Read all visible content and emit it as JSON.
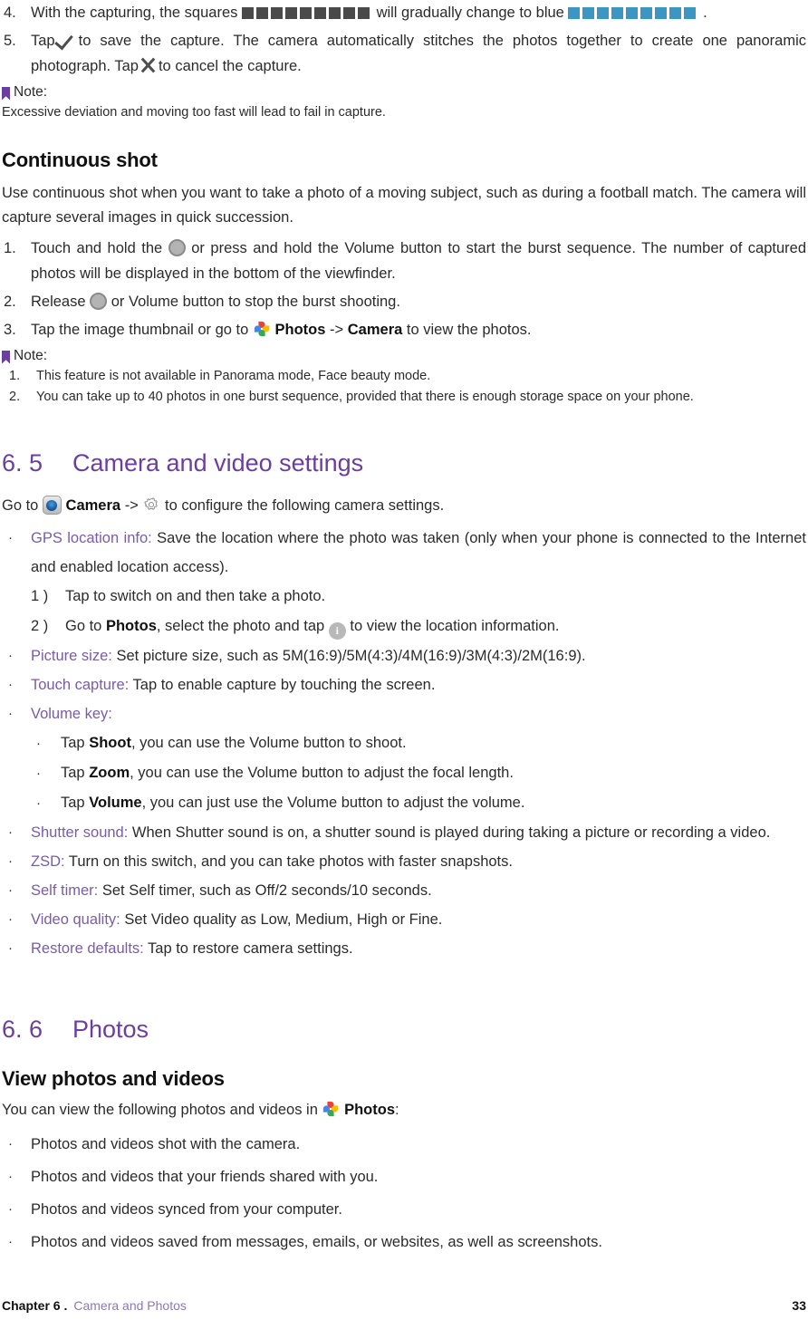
{
  "colors": {
    "accent_purple": "#6b3fa0",
    "keyword_purple": "#7a5ca8",
    "square_dark": "#4a4a4a",
    "square_blue": "#3b97c2",
    "body_text": "#2b2b2b"
  },
  "steps_panorama": [
    {
      "marker": "4.",
      "text_before": "With the capturing, the squares",
      "text_middle": "will gradually change to blue",
      "text_after": ".",
      "squares_dark_count": 9,
      "squares_blue_count": 9
    },
    {
      "marker": "5.",
      "part1": "Tap",
      "part2": "to save the capture. The camera automatically stitches the photos together to create one panoramic photograph. Tap",
      "part3": "to cancel the capture.",
      "icon_save": "check-icon",
      "icon_cancel": "close-icon"
    }
  ],
  "note_panorama": {
    "label": "Note:",
    "body": "Excessive deviation and moving too fast will lead to fail in capture."
  },
  "continuous_shot": {
    "heading": "Continuous shot",
    "intro": "Use continuous shot when you want to take a photo of a moving subject, such as during a football match. The camera will capture several images in quick succession.",
    "steps": [
      {
        "marker": "1.",
        "part1": "Touch and hold the",
        "part2": "or press and hold the Volume button to start the burst sequence. The number of captured photos will be displayed in the bottom of the viewfinder.",
        "icon": "shutter-button-icon"
      },
      {
        "marker": "2.",
        "part1": "Release",
        "part2": "or Volume button to stop the burst shooting.",
        "icon": "shutter-button-icon"
      },
      {
        "marker": "3.",
        "part1": "Tap the image thumbnail or go to",
        "app": "Photos",
        "arrow": "->",
        "target": "Camera",
        "part2": "to view the photos.",
        "icon": "google-photos-icon"
      }
    ],
    "note": {
      "label": "Note:",
      "items": [
        {
          "marker": "1.",
          "text": "This feature is not available in Panorama mode, Face beauty mode."
        },
        {
          "marker": "2.",
          "text": "You can take up to 40 photos in one burst sequence, provided that there is enough storage space on your phone."
        }
      ]
    }
  },
  "section_65": {
    "number": "6. 5",
    "title": "Camera and video settings",
    "intro": {
      "part1": "Go to",
      "app": "Camera",
      "arrow": "->",
      "part2": "to configure the following camera settings.",
      "icon_camera": "camera-app-icon",
      "icon_gear": "settings-gear-icon"
    },
    "settings": [
      {
        "term": "GPS location info:",
        "desc": "Save the location where the photo was taken (only when your phone is connected to the Internet and enabled location access).",
        "substeps": [
          {
            "marker": "1 )",
            "text": "Tap to switch on and then take a photo."
          },
          {
            "marker": "2 )",
            "part1": "Go to",
            "bold": "Photos",
            "part2": ", select the photo and tap",
            "part3": "to view the location information.",
            "icon": "info-icon"
          }
        ]
      },
      {
        "term": "Picture size:",
        "desc": "Set picture size, such as 5M(16:9)/5M(4:3)/4M(16:9)/3M(4:3)/2M(16:9)."
      },
      {
        "term": "Touch capture:",
        "desc": "Tap to enable capture by touching the screen."
      },
      {
        "term": "Volume key:",
        "desc": "",
        "subbullets": [
          {
            "part1": "Tap",
            "bold": "Shoot",
            "part2": ", you can use the Volume button to shoot."
          },
          {
            "part1": "Tap",
            "bold": "Zoom",
            "part2": ", you can use the Volume button to adjust the focal length."
          },
          {
            "part1": "Tap",
            "bold": "Volume",
            "part2": ", you can just use the Volume button to adjust the volume."
          }
        ]
      },
      {
        "term": "Shutter sound:",
        "desc": "When Shutter sound is on, a shutter sound is played during taking a picture or recording a video."
      },
      {
        "term": "ZSD:",
        "desc": "Turn on this switch, and you can take photos with faster snapshots."
      },
      {
        "term": "Self timer:",
        "desc": "Set Self timer, such as Off/2 seconds/10 seconds."
      },
      {
        "term": "Video quality:",
        "desc": "Set Video quality as Low, Medium, High or Fine."
      },
      {
        "term": "Restore defaults:",
        "desc": "Tap to restore camera settings."
      }
    ]
  },
  "section_66": {
    "number": "6. 6",
    "title": "Photos",
    "heading": "View photos and videos",
    "intro_part1": "You can view the following photos and videos in",
    "intro_app": "Photos",
    "intro_part2": ":",
    "intro_icon": "google-photos-icon",
    "bullets": [
      "Photos and videos shot with the camera.",
      "Photos and videos that your friends shared with you.",
      "Photos and videos synced from your computer.",
      "Photos and videos saved from messages, emails, or websites, as well as screenshots."
    ]
  },
  "footer": {
    "chapter": "Chapter 6 .",
    "chapter_name": "Camera and Photos",
    "page_number": "33"
  }
}
